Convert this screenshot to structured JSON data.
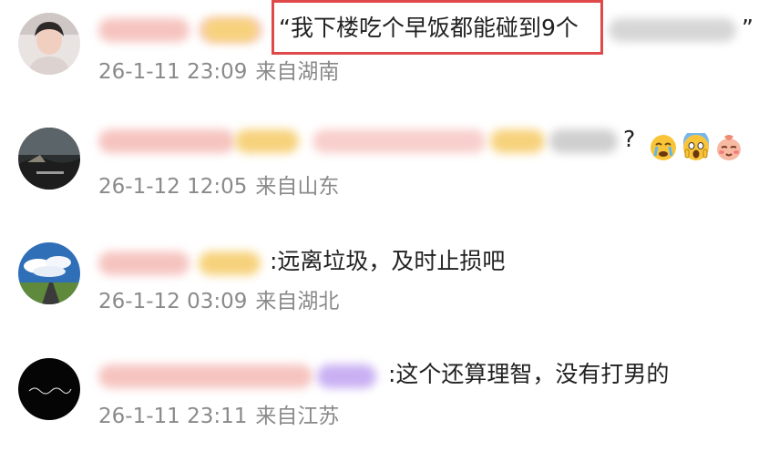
{
  "comments": [
    {
      "text": "“我下楼吃个早饭都能碰到9个",
      "text_tail": "”",
      "date": "26-1-11 23:09",
      "location": "来自湖南"
    },
    {
      "text": "?",
      "emojis": [
        "crying-face-emoji",
        "screaming-face-emoji",
        "shy-face-emoji"
      ],
      "date": "26-1-12 12:05",
      "location": "来自山东"
    },
    {
      "text": ":远离垃圾，及时止损吧",
      "date": "26-1-12 03:09",
      "location": "来自湖北"
    },
    {
      "text": ":这个还算理智，没有打男的",
      "date": "26-1-11 23:11",
      "location": "来自江苏"
    }
  ],
  "colors": {
    "highlight_border": "#e0494a",
    "meta_text": "#8a8a8a",
    "body_text": "#222222"
  }
}
